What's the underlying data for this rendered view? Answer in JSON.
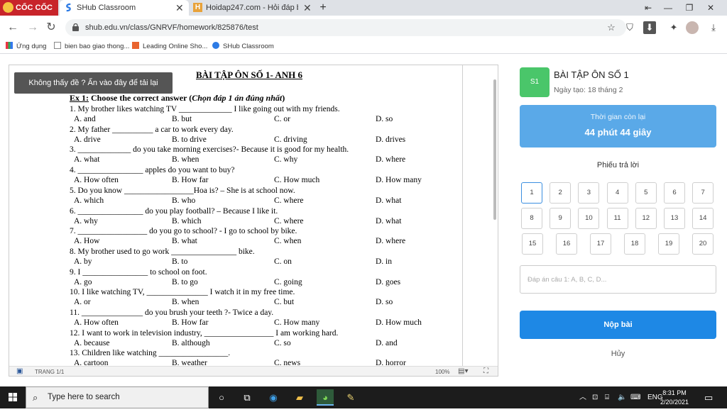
{
  "browser": {
    "logo": "CỐC CỐC",
    "tabs": [
      {
        "title": "SHub Classroom",
        "active": true
      },
      {
        "title": "Hoidap247.com - Hỏi đáp bài",
        "active": false
      }
    ],
    "new_tab": "+",
    "url": "shub.edu.vn/class/GNRVF/homework/825876/test",
    "bookmarks": [
      {
        "label": "Ứng dụng"
      },
      {
        "label": "bien bao giao thong..."
      },
      {
        "label": "Leading Online Sho..."
      },
      {
        "label": "SHub Classroom"
      }
    ]
  },
  "document": {
    "reload_banner": "Không thấy đề ? Ấn vào đây để tải lại",
    "title": "BÀI TẬP ÔN SỐ 1- ANH 6",
    "exercise_label": "Ex 1:",
    "exercise_text": " Choose the correct answer (",
    "exercise_italic": "Chọn đáp 1 án đúng nhất",
    "exercise_end": ")",
    "questions": [
      {
        "text": "1. My brother likes watching TV _____________ I like going out with my friends.",
        "options": [
          "A. and",
          "B. but",
          "C. or",
          "D. so"
        ]
      },
      {
        "text": "2. My father __________ a car to work every day.",
        "options": [
          "A. drive",
          "B. to drive",
          "C. driving",
          "D. drives"
        ]
      },
      {
        "text": "3. _____________ do you take morning exercises?- Because it is good for my health.",
        "options": [
          "A. what",
          "B. when",
          "C. why",
          "D. where"
        ]
      },
      {
        "text": "4. ________________ apples do you want to buy?",
        "options": [
          "A. How often",
          "B. How far",
          "C.  How much",
          "D. How many"
        ]
      },
      {
        "text": "5. Do you know _________________Hoa is?  – She is at school now.",
        "options": [
          "A. which",
          "B. who",
          "C. where",
          "D. what"
        ]
      },
      {
        "text": "6. ________________ do you play football?  – Because I like it.",
        "options": [
          "A. why",
          "B. which",
          "C. where",
          "D. what"
        ]
      },
      {
        "text": "7. _________________ do you go to school? - I go to school by bike.",
        "options": [
          "A. How",
          "B. what",
          "C. when",
          "D. where"
        ]
      },
      {
        "text": "8. My brother used to go work ________________ bike.",
        "options": [
          "A. by",
          "B. to",
          "C. on",
          "D. in"
        ]
      },
      {
        "text": "9. I ________________ to school on foot.",
        "options": [
          "A. go",
          "B. to go",
          "C. going",
          "D. goes"
        ]
      },
      {
        "text": "10. I like watching TV, _______________ I watch it in my free time.",
        "options": [
          "A. or",
          "B. when",
          "C. but",
          "D. so"
        ]
      },
      {
        "text": "11. _______________ do you brush your teeth ?-  Twice a day.",
        "options": [
          "A. How often",
          "B. How far",
          "C. How many",
          "D. How much"
        ]
      },
      {
        "text": "12. I want to work in television industry, _________________ I am working hard.",
        "options": [
          "A. because",
          "B. although",
          "C. so",
          "D. and"
        ]
      },
      {
        "text": "13. Children like watching _________________.",
        "options": [
          "A. cartoon",
          "B. weather",
          "C. news",
          "D. horror"
        ]
      }
    ],
    "status_page": "TRANG 1/1",
    "status_zoom": "100%"
  },
  "panel": {
    "badge": "S1",
    "title": "BÀI TẬP ÔN SỐ 1",
    "created": "Ngày tạo: 18 tháng 2",
    "timer_label": "Thời gian còn lại",
    "timer_value": "44 phút 44 giây",
    "sheet_title": "Phiếu trả lời",
    "question_numbers": [
      "1",
      "2",
      "3",
      "4",
      "5",
      "6",
      "7",
      "8",
      "9",
      "10",
      "11",
      "12",
      "13",
      "14",
      "15",
      "16",
      "17",
      "18",
      "19",
      "20"
    ],
    "active_question": "1",
    "answer_placeholder": "Đáp án câu 1: A, B, C, D...",
    "submit_label": "Nộp bài",
    "cancel_label": "Hủy"
  },
  "taskbar": {
    "search_placeholder": "Type here to search",
    "language": "ENG",
    "time": "8:31 PM",
    "date": "2/20/2021"
  }
}
